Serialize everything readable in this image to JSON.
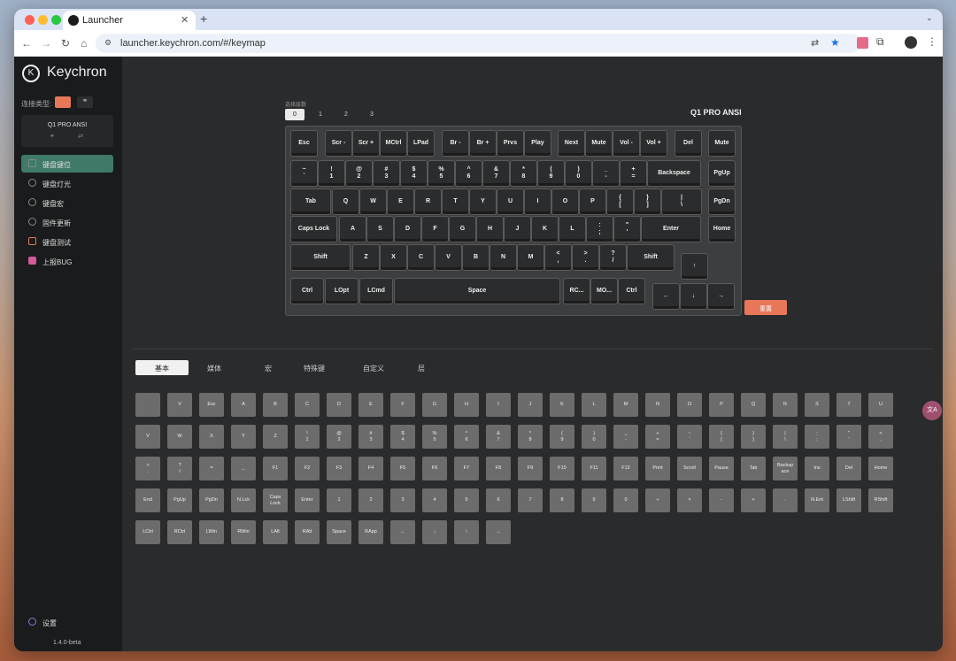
{
  "browser": {
    "tab_title": "Launcher",
    "url": "launcher.keychron.com/#/keymap",
    "new_tab": "+"
  },
  "sidebar": {
    "brand": "Keychron",
    "connection_label": "连接类型:",
    "device_name": "Q1 PRO ANSI",
    "items": [
      {
        "label": "键盘键位",
        "icon": "keyboard-icon"
      },
      {
        "label": "键盘灯光",
        "icon": "bulb-icon"
      },
      {
        "label": "键盘宏",
        "icon": "macro-icon"
      },
      {
        "label": "固件更新",
        "icon": "update-icon"
      },
      {
        "label": "键盘测试",
        "icon": "test-icon"
      },
      {
        "label": "上报BUG",
        "icon": "bug-icon"
      }
    ],
    "settings": "设置",
    "version": "1.4.0-beta"
  },
  "layer": {
    "label": "选择层数",
    "options": [
      "0",
      "1",
      "2",
      "3"
    ],
    "selected": "0"
  },
  "model": "Q1 PRO ANSI",
  "reset": "重置",
  "palette_tabs": [
    "基本",
    "媒体",
    "宏",
    "特殊键",
    "自定义",
    "层"
  ],
  "colors": {
    "accent": "#e8775a",
    "selected": "#3f7a68"
  },
  "keyboard": {
    "rows": [
      [
        "Esc",
        "Scr -",
        "Scr +",
        "MCtrl",
        "LPad",
        "Br -",
        "Br +",
        "Prvs",
        "Play",
        "Next",
        "Mute",
        "Vol -",
        "Vol +",
        "Del",
        "Mute"
      ],
      [
        "~\n`",
        "!\n1",
        "@\n2",
        "#\n3",
        "$\n4",
        "%\n5",
        "^\n6",
        "&\n7",
        "*\n8",
        "(\n9",
        ")\n0",
        "_\n-",
        "+\n=",
        "Backspace",
        "PgUp"
      ],
      [
        "Tab",
        "Q",
        "W",
        "E",
        "R",
        "T",
        "Y",
        "U",
        "I",
        "O",
        "P",
        "{\n[",
        "}\n]",
        "|\n\\",
        "PgDn"
      ],
      [
        "Caps Lock",
        "A",
        "S",
        "D",
        "F",
        "G",
        "H",
        "J",
        "K",
        "L",
        ":\n;",
        "\"\n'",
        "Enter",
        "Home"
      ],
      [
        "Shift",
        "Z",
        "X",
        "C",
        "V",
        "B",
        "N",
        "M",
        "<\n,",
        ">\n.",
        "?\n/",
        "Shift",
        "↑"
      ],
      [
        "Ctrl",
        "LOpt",
        "LCmd",
        "Space",
        "RC...",
        "MO...",
        "Ctrl",
        "←",
        "↓",
        "→"
      ]
    ]
  },
  "palette": [
    "",
    "V",
    "Esc",
    "A",
    "B",
    "C",
    "D",
    "E",
    "F",
    "G",
    "H",
    "I",
    "J",
    "K",
    "L",
    "M",
    "N",
    "O",
    "P",
    "Q",
    "R",
    "S",
    "T",
    "U",
    "V",
    "W",
    "X",
    "Y",
    "Z",
    "!\n1",
    "@\n2",
    "#\n3",
    "$\n4",
    "%\n5",
    "^\n6",
    "&\n7",
    "*\n8",
    "(\n9",
    ")\n0",
    "_\n-",
    "+\n=",
    "~\n`",
    "{\n[",
    "}\n]",
    "|\n\\",
    ":\n;",
    "\"\n'",
    "<\n,",
    ">\n.",
    "?\n/",
    "=",
    "_",
    "F1",
    "F2",
    "F3",
    "F4",
    "F5",
    "F6",
    "F7",
    "F8",
    "F9",
    "F10",
    "F11",
    "F12",
    "Print",
    "Scroll",
    "Pause",
    "Tab",
    "Backsp\nace",
    "Ins",
    "Del",
    "Home",
    "End",
    "PgUp",
    "PgDn",
    "N.Lck",
    "Caps\nLock",
    "Enter",
    "1",
    "2",
    "3",
    "4",
    "5",
    "6",
    "7",
    "8",
    "9",
    "0",
    "÷",
    "×",
    "-",
    "+",
    ".",
    "N.Ent",
    "LShift",
    "RShift",
    "LCtrl",
    "RCtrl",
    "LWin",
    "RWin",
    "LAlt",
    "RAlt",
    "Space",
    "RApp",
    "←",
    "↓",
    "↑",
    "→"
  ]
}
